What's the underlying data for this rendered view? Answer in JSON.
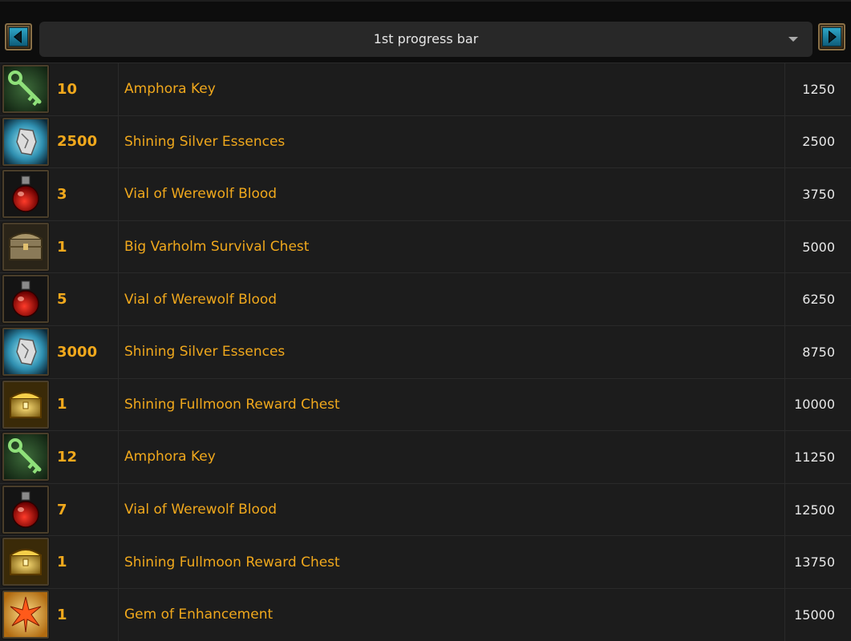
{
  "header": {
    "selected_option": "1st progress bar",
    "prev_icon": "arrow-left-icon",
    "next_icon": "arrow-right-icon"
  },
  "colors": {
    "accent_gold": "#f0a81c",
    "row_bg": "#1c1c1c",
    "page_bg": "#0d0d0d"
  },
  "rewards": [
    {
      "icon": "amphora-key-icon",
      "qty": "10",
      "name": "Amphora Key",
      "points": "1250"
    },
    {
      "icon": "silver-essence-icon",
      "qty": "2500",
      "name": "Shining Silver Essences",
      "points": "2500"
    },
    {
      "icon": "werewolf-blood-vial-icon",
      "qty": "3",
      "name": "Vial of Werewolf Blood",
      "points": "3750"
    },
    {
      "icon": "survival-chest-icon",
      "qty": "1",
      "name": "Big Varholm Survival Chest",
      "points": "5000"
    },
    {
      "icon": "werewolf-blood-vial-icon",
      "qty": "5",
      "name": "Vial of Werewolf Blood",
      "points": "6250"
    },
    {
      "icon": "silver-essence-icon",
      "qty": "3000",
      "name": "Shining Silver Essences",
      "points": "8750"
    },
    {
      "icon": "fullmoon-chest-icon",
      "qty": "1",
      "name": "Shining Fullmoon Reward Chest",
      "points": "10000"
    },
    {
      "icon": "amphora-key-icon",
      "qty": "12",
      "name": "Amphora Key",
      "points": "11250"
    },
    {
      "icon": "werewolf-blood-vial-icon",
      "qty": "7",
      "name": "Vial of Werewolf Blood",
      "points": "12500"
    },
    {
      "icon": "fullmoon-chest-icon",
      "qty": "1",
      "name": "Shining Fullmoon Reward Chest",
      "points": "13750"
    },
    {
      "icon": "enhancement-gem-icon",
      "qty": "1",
      "name": "Gem of Enhancement",
      "points": "15000"
    }
  ]
}
